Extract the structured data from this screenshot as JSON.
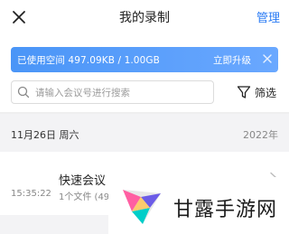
{
  "header": {
    "title": "我的录制",
    "manage_label": "管理"
  },
  "storage": {
    "used_text": "已使用空间 497.09KB / 1.00GB",
    "upgrade_label": "立即升级"
  },
  "search": {
    "placeholder": "请输入会议号进行搜索",
    "value": ""
  },
  "filter": {
    "label": "筛选"
  },
  "date_group": {
    "date": "11月26日 周六",
    "year": "2022年"
  },
  "recordings": [
    {
      "title": "快速会议",
      "time": "15:35:22",
      "files": "1个文件 (49"
    }
  ],
  "watermark": {
    "text": "甘露手游网"
  },
  "colors": {
    "accent": "#2a7bf4",
    "storage_bar": "#5aa0fb",
    "group_background": "#f3f3f5"
  }
}
